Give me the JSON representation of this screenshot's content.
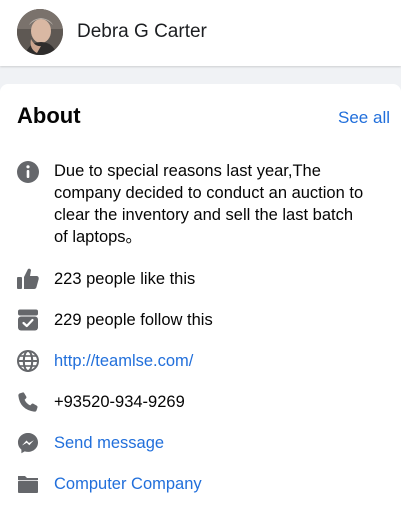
{
  "header": {
    "name": "Debra G Carter"
  },
  "about": {
    "title": "About",
    "see_all_label": "See all",
    "description": "Due to special reasons last year,The company decided to conduct an auction to clear the inventory and sell the last batch of laptops。",
    "likes": "223 people like this",
    "follows": "229 people follow this",
    "website": "http://teamlse.com/",
    "phone": "+93520-934-9269",
    "message": "Send message",
    "category": "Computer Company"
  },
  "icons": {
    "info": "info-icon",
    "like": "thumbs-up-icon",
    "follow": "follow-check-icon",
    "website": "globe-icon",
    "phone": "phone-icon",
    "message": "messenger-icon",
    "category": "folder-icon"
  },
  "colors": {
    "link": "#216fdb",
    "icon": "#65676b",
    "background": "#f0f2f5",
    "card": "#ffffff"
  }
}
